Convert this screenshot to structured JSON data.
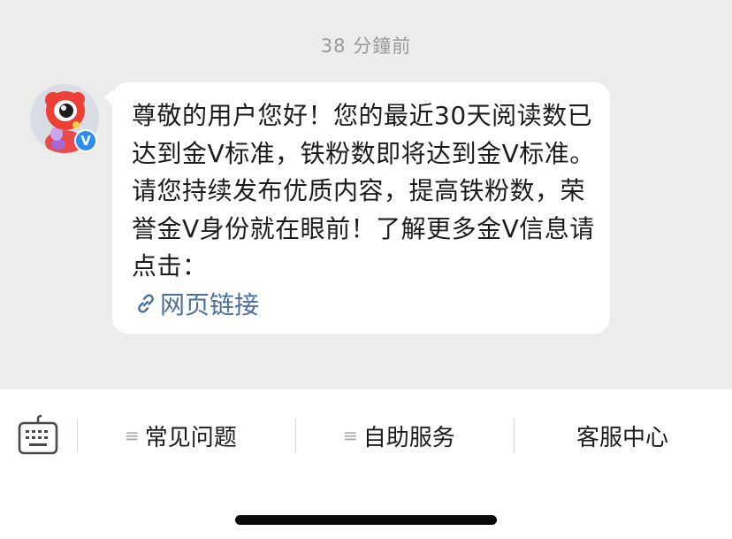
{
  "chat": {
    "timestamp": "38 分鐘前",
    "message": {
      "text": "尊敬的用户您好！您的最近30天阅读数已达到金V标准，铁粉数即将达到金V标准。请您持续发布优质内容，提高铁粉数，荣誉金V身份就在眼前！了解更多金V信息请点击：",
      "link_label": "网页链接",
      "link_icon": "link-icon"
    },
    "sender": {
      "avatar_icon": "weibo-mascot-avatar",
      "badge_text": "V",
      "badge_color": "#2d8cf0"
    }
  },
  "toolbar": {
    "keyboard_icon": "keyboard-icon",
    "items": [
      {
        "label": "常见问题",
        "icon": "menu-icon"
      },
      {
        "label": "自助服务",
        "icon": "menu-icon"
      },
      {
        "label": "客服中心"
      }
    ]
  },
  "colors": {
    "chat_background": "#ececec",
    "link": "#4a6f9a",
    "text": "#1c1c1c"
  }
}
